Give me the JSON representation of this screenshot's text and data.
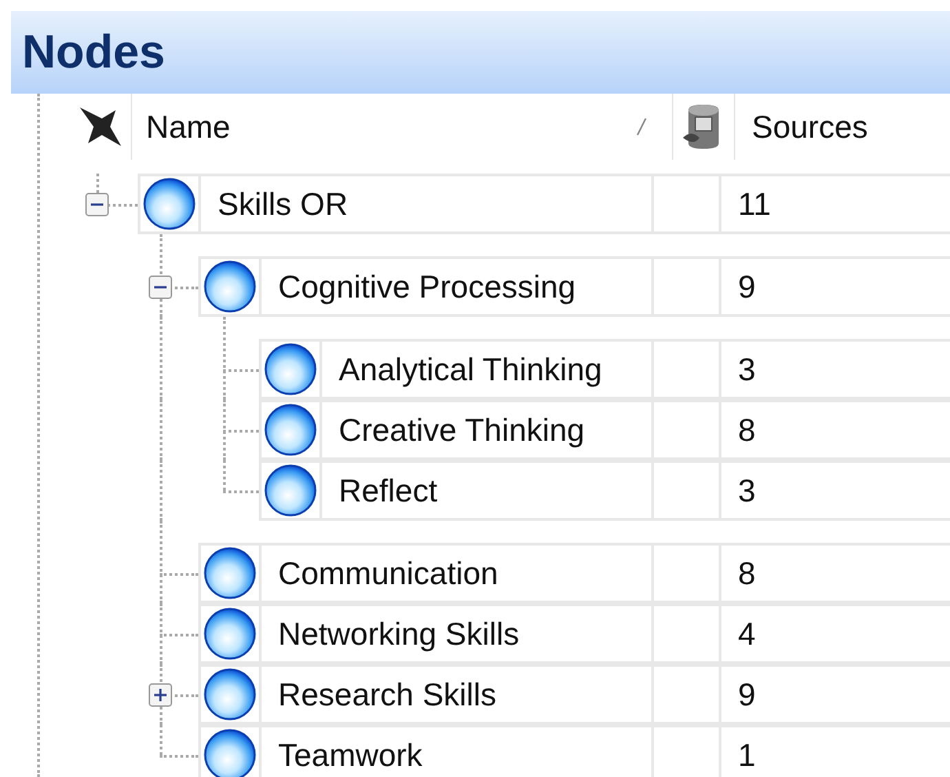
{
  "panel": {
    "title": "Nodes"
  },
  "columns": [
    {
      "label": "Name"
    },
    {
      "label": "Sources"
    }
  ],
  "nodes": [
    {
      "name": "Skills OR",
      "sources": "11",
      "expanded": true,
      "children": [
        {
          "name": "Cognitive Processing",
          "sources": "9",
          "expanded": true,
          "children": [
            {
              "name": "Analytical Thinking",
              "sources": "3"
            },
            {
              "name": "Creative Thinking",
              "sources": "8"
            },
            {
              "name": "Reflect",
              "sources": "3"
            }
          ]
        },
        {
          "name": "Communication",
          "sources": "8"
        },
        {
          "name": "Networking Skills",
          "sources": "4"
        },
        {
          "name": "Research Skills",
          "sources": "9",
          "expanded": false
        },
        {
          "name": "Teamwork",
          "sources": "1"
        }
      ]
    }
  ]
}
